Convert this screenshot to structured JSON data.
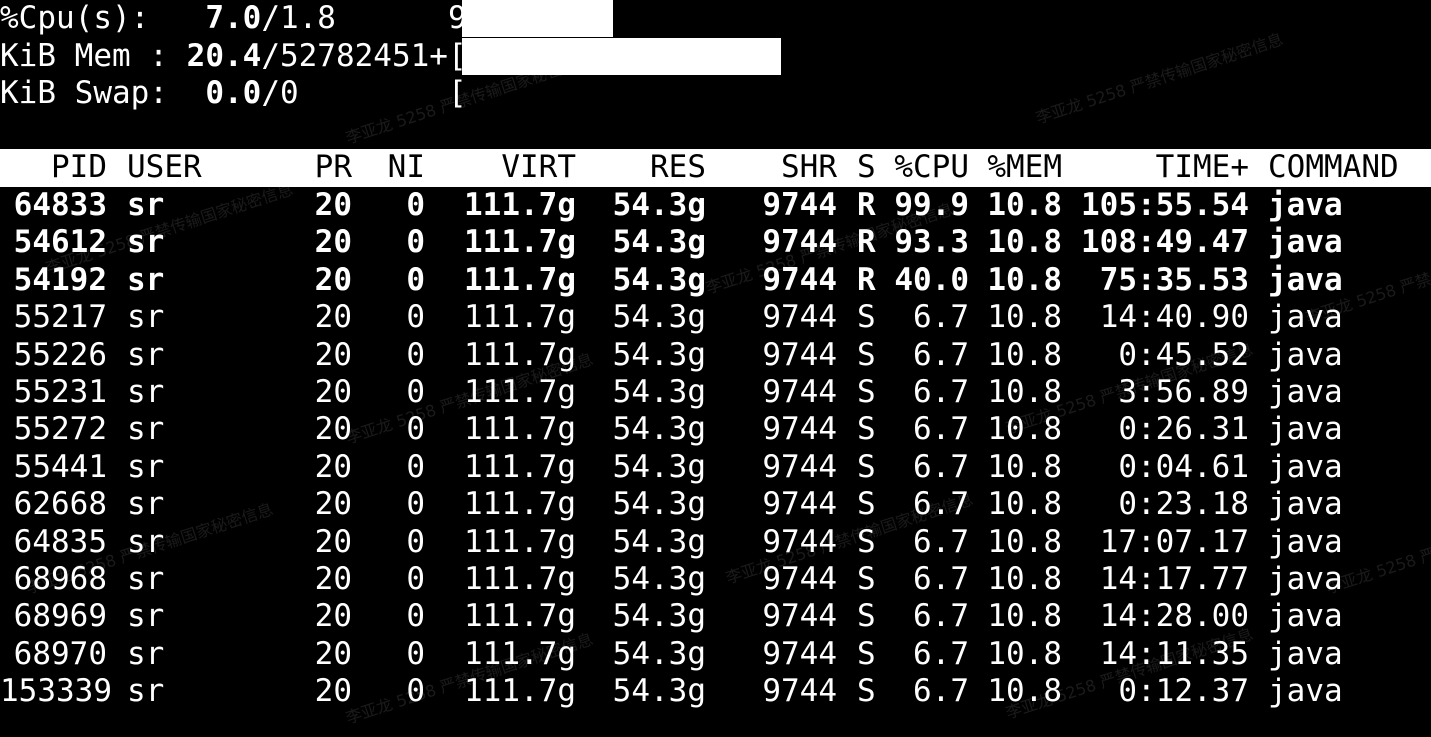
{
  "summary": {
    "cpu": {
      "label": "%Cpu(s):",
      "value_bold": "7.0",
      "rest": "/1.8",
      "count": "9",
      "bracket": "["
    },
    "mem": {
      "label": "KiB Mem :",
      "value_bold": "20.4",
      "rest": "/52782451+",
      "bracket": "["
    },
    "swap": {
      "label": "KiB Swap:",
      "value_bold": "0.0",
      "rest": "/0",
      "bracket": "["
    }
  },
  "columns": {
    "pid": "PID",
    "user": "USER",
    "pr": "PR",
    "ni": "NI",
    "virt": "VIRT",
    "res": "RES",
    "shr": "SHR",
    "s": "S",
    "cpu": "%CPU",
    "mem": "%MEM",
    "time": "TIME+",
    "command": "COMMAND"
  },
  "processes": [
    {
      "pid": "64833",
      "user": "sr",
      "pr": "20",
      "ni": "0",
      "virt": "111.7g",
      "res": "54.3g",
      "shr": "9744",
      "s": "R",
      "cpu": "99.9",
      "mem": "10.8",
      "time": "105:55.54",
      "command": "java",
      "bold": true
    },
    {
      "pid": "54612",
      "user": "sr",
      "pr": "20",
      "ni": "0",
      "virt": "111.7g",
      "res": "54.3g",
      "shr": "9744",
      "s": "R",
      "cpu": "93.3",
      "mem": "10.8",
      "time": "108:49.47",
      "command": "java",
      "bold": true
    },
    {
      "pid": "54192",
      "user": "sr",
      "pr": "20",
      "ni": "0",
      "virt": "111.7g",
      "res": "54.3g",
      "shr": "9744",
      "s": "R",
      "cpu": "40.0",
      "mem": "10.8",
      "time": "75:35.53",
      "command": "java",
      "bold": true
    },
    {
      "pid": "55217",
      "user": "sr",
      "pr": "20",
      "ni": "0",
      "virt": "111.7g",
      "res": "54.3g",
      "shr": "9744",
      "s": "S",
      "cpu": "6.7",
      "mem": "10.8",
      "time": "14:40.90",
      "command": "java",
      "bold": false
    },
    {
      "pid": "55226",
      "user": "sr",
      "pr": "20",
      "ni": "0",
      "virt": "111.7g",
      "res": "54.3g",
      "shr": "9744",
      "s": "S",
      "cpu": "6.7",
      "mem": "10.8",
      "time": "0:45.52",
      "command": "java",
      "bold": false
    },
    {
      "pid": "55231",
      "user": "sr",
      "pr": "20",
      "ni": "0",
      "virt": "111.7g",
      "res": "54.3g",
      "shr": "9744",
      "s": "S",
      "cpu": "6.7",
      "mem": "10.8",
      "time": "3:56.89",
      "command": "java",
      "bold": false
    },
    {
      "pid": "55272",
      "user": "sr",
      "pr": "20",
      "ni": "0",
      "virt": "111.7g",
      "res": "54.3g",
      "shr": "9744",
      "s": "S",
      "cpu": "6.7",
      "mem": "10.8",
      "time": "0:26.31",
      "command": "java",
      "bold": false
    },
    {
      "pid": "55441",
      "user": "sr",
      "pr": "20",
      "ni": "0",
      "virt": "111.7g",
      "res": "54.3g",
      "shr": "9744",
      "s": "S",
      "cpu": "6.7",
      "mem": "10.8",
      "time": "0:04.61",
      "command": "java",
      "bold": false
    },
    {
      "pid": "62668",
      "user": "sr",
      "pr": "20",
      "ni": "0",
      "virt": "111.7g",
      "res": "54.3g",
      "shr": "9744",
      "s": "S",
      "cpu": "6.7",
      "mem": "10.8",
      "time": "0:23.18",
      "command": "java",
      "bold": false
    },
    {
      "pid": "64835",
      "user": "sr",
      "pr": "20",
      "ni": "0",
      "virt": "111.7g",
      "res": "54.3g",
      "shr": "9744",
      "s": "S",
      "cpu": "6.7",
      "mem": "10.8",
      "time": "17:07.17",
      "command": "java",
      "bold": false
    },
    {
      "pid": "68968",
      "user": "sr",
      "pr": "20",
      "ni": "0",
      "virt": "111.7g",
      "res": "54.3g",
      "shr": "9744",
      "s": "S",
      "cpu": "6.7",
      "mem": "10.8",
      "time": "14:17.77",
      "command": "java",
      "bold": false
    },
    {
      "pid": "68969",
      "user": "sr",
      "pr": "20",
      "ni": "0",
      "virt": "111.7g",
      "res": "54.3g",
      "shr": "9744",
      "s": "S",
      "cpu": "6.7",
      "mem": "10.8",
      "time": "14:28.00",
      "command": "java",
      "bold": false
    },
    {
      "pid": "68970",
      "user": "sr",
      "pr": "20",
      "ni": "0",
      "virt": "111.7g",
      "res": "54.3g",
      "shr": "9744",
      "s": "S",
      "cpu": "6.7",
      "mem": "10.8",
      "time": "14:11.35",
      "command": "java",
      "bold": false
    },
    {
      "pid": "153339",
      "user": "sr",
      "pr": "20",
      "ni": "0",
      "virt": "111.7g",
      "res": "54.3g",
      "shr": "9744",
      "s": "S",
      "cpu": "6.7",
      "mem": "10.8",
      "time": "0:12.37",
      "command": "java",
      "bold": false
    }
  ],
  "watermark_text": "李亚龙 5258 严禁传输国家秘密信息",
  "colors": {
    "background": "#000000",
    "text": "#ffffff",
    "header_bg": "#ffffff",
    "header_text": "#000000"
  }
}
